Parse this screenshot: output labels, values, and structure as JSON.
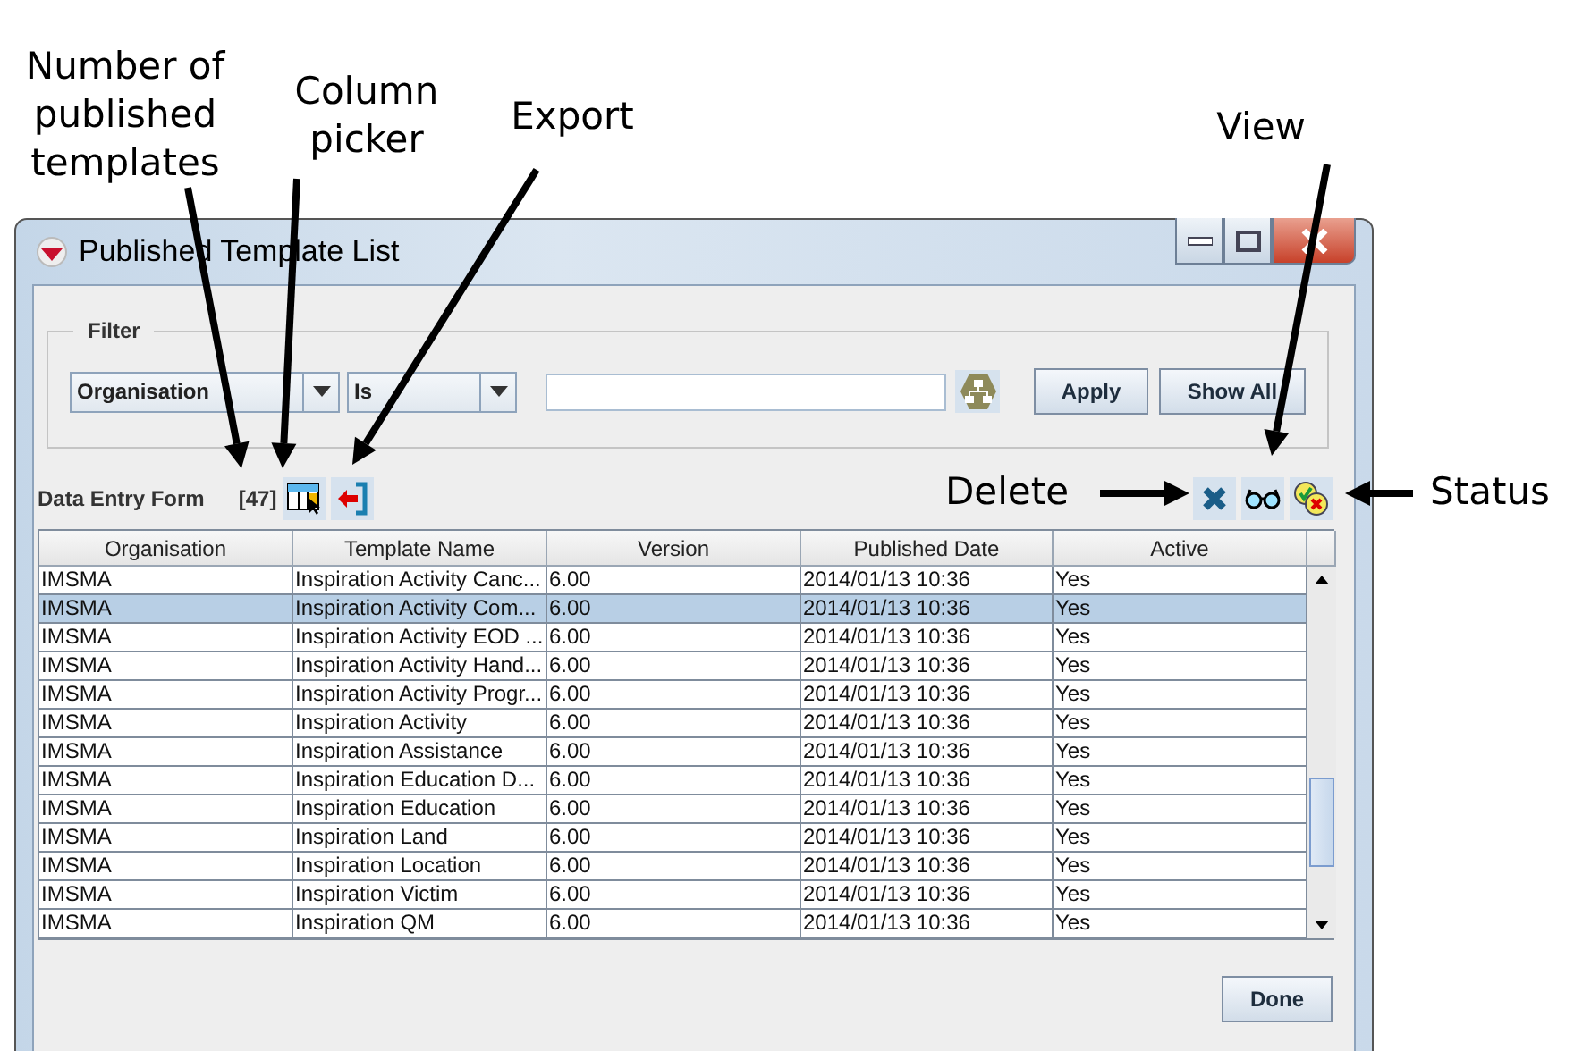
{
  "annotations": [
    {
      "text": "Number of published templates"
    },
    {
      "text": "Column picker"
    },
    {
      "text": "Export"
    },
    {
      "text": "View"
    },
    {
      "text": "Delete"
    },
    {
      "text": "Status"
    }
  ],
  "window": {
    "title": "Published Template List"
  },
  "filter": {
    "legend": "Filter",
    "field": "Organisation",
    "operator": "Is",
    "buttons": [
      "Apply",
      "Show All"
    ]
  },
  "toolbar": {
    "label": "Data Entry Form",
    "count": "[47]"
  },
  "table": {
    "columns": [
      "Organisation",
      "Template Name",
      "Version",
      "Published Date",
      "Active"
    ],
    "rows": [
      {
        "cells": [
          "IMSMA",
          "Inspiration Activity Canc...",
          "6.00",
          "2014/01/13 10:36",
          "Yes"
        ],
        "selected": false
      },
      {
        "cells": [
          "IMSMA",
          "Inspiration Activity Com...",
          "6.00",
          "2014/01/13 10:36",
          "Yes"
        ],
        "selected": true
      },
      {
        "cells": [
          "IMSMA",
          "Inspiration Activity EOD ...",
          "6.00",
          "2014/01/13 10:36",
          "Yes"
        ],
        "selected": false
      },
      {
        "cells": [
          "IMSMA",
          "Inspiration Activity Hand...",
          "6.00",
          "2014/01/13 10:36",
          "Yes"
        ],
        "selected": false
      },
      {
        "cells": [
          "IMSMA",
          "Inspiration Activity Progr...",
          "6.00",
          "2014/01/13 10:36",
          "Yes"
        ],
        "selected": false
      },
      {
        "cells": [
          "IMSMA",
          "Inspiration Activity",
          "6.00",
          "2014/01/13 10:36",
          "Yes"
        ],
        "selected": false
      },
      {
        "cells": [
          "IMSMA",
          "Inspiration Assistance",
          "6.00",
          "2014/01/13 10:36",
          "Yes"
        ],
        "selected": false
      },
      {
        "cells": [
          "IMSMA",
          "Inspiration Education D...",
          "6.00",
          "2014/01/13 10:36",
          "Yes"
        ],
        "selected": false
      },
      {
        "cells": [
          "IMSMA",
          "Inspiration Education",
          "6.00",
          "2014/01/13 10:36",
          "Yes"
        ],
        "selected": false
      },
      {
        "cells": [
          "IMSMA",
          "Inspiration Land",
          "6.00",
          "2014/01/13 10:36",
          "Yes"
        ],
        "selected": false
      },
      {
        "cells": [
          "IMSMA",
          "Inspiration Location",
          "6.00",
          "2014/01/13 10:36",
          "Yes"
        ],
        "selected": false
      },
      {
        "cells": [
          "IMSMA",
          "Inspiration Victim",
          "6.00",
          "2014/01/13 10:36",
          "Yes"
        ],
        "selected": false
      },
      {
        "cells": [
          "IMSMA",
          "Inspiration QM",
          "6.00",
          "2014/01/13 10:36",
          "Yes"
        ],
        "selected": false
      }
    ]
  },
  "footer": {
    "button": "Done"
  }
}
